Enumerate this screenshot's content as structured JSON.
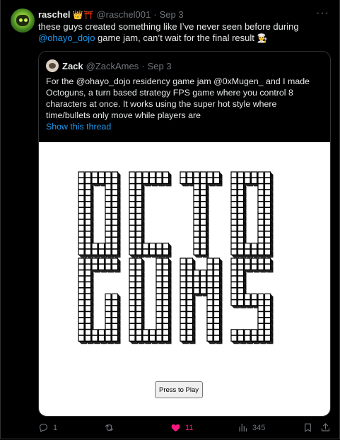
{
  "post": {
    "author_name": "raschel",
    "author_emoji": "👑⛩️",
    "author_handle": "@raschel001",
    "date": "Sep 3",
    "more_label": "···",
    "text_before": "these guys created something like I’ve never seen before during ",
    "mention": "@ohayo_dojo",
    "text_after": " game jam, can’t wait for the final result ",
    "text_emoji": "👨‍🍳"
  },
  "quote": {
    "author_name": "Zack",
    "author_handle": "@ZackAmes",
    "date": "Sep 3",
    "text": "For the @ohayo_dojo residency game jam @0xMugen_ and I made Octoguns, a turn based strategy FPS game where you control 8 characters at once. It works using the super hot style where time/bullets only move while players are",
    "show_thread": "Show this thread"
  },
  "media": {
    "logo_text_line1": "OCTO",
    "logo_text_line2": "GUNS",
    "play_button": "Press to Play"
  },
  "actions": {
    "reply_count": "1",
    "like_count": "11",
    "views_count": "345"
  },
  "colors": {
    "background": "#000000",
    "accent": "#1d9bf0",
    "like": "#f91880",
    "muted": "#71767b"
  }
}
